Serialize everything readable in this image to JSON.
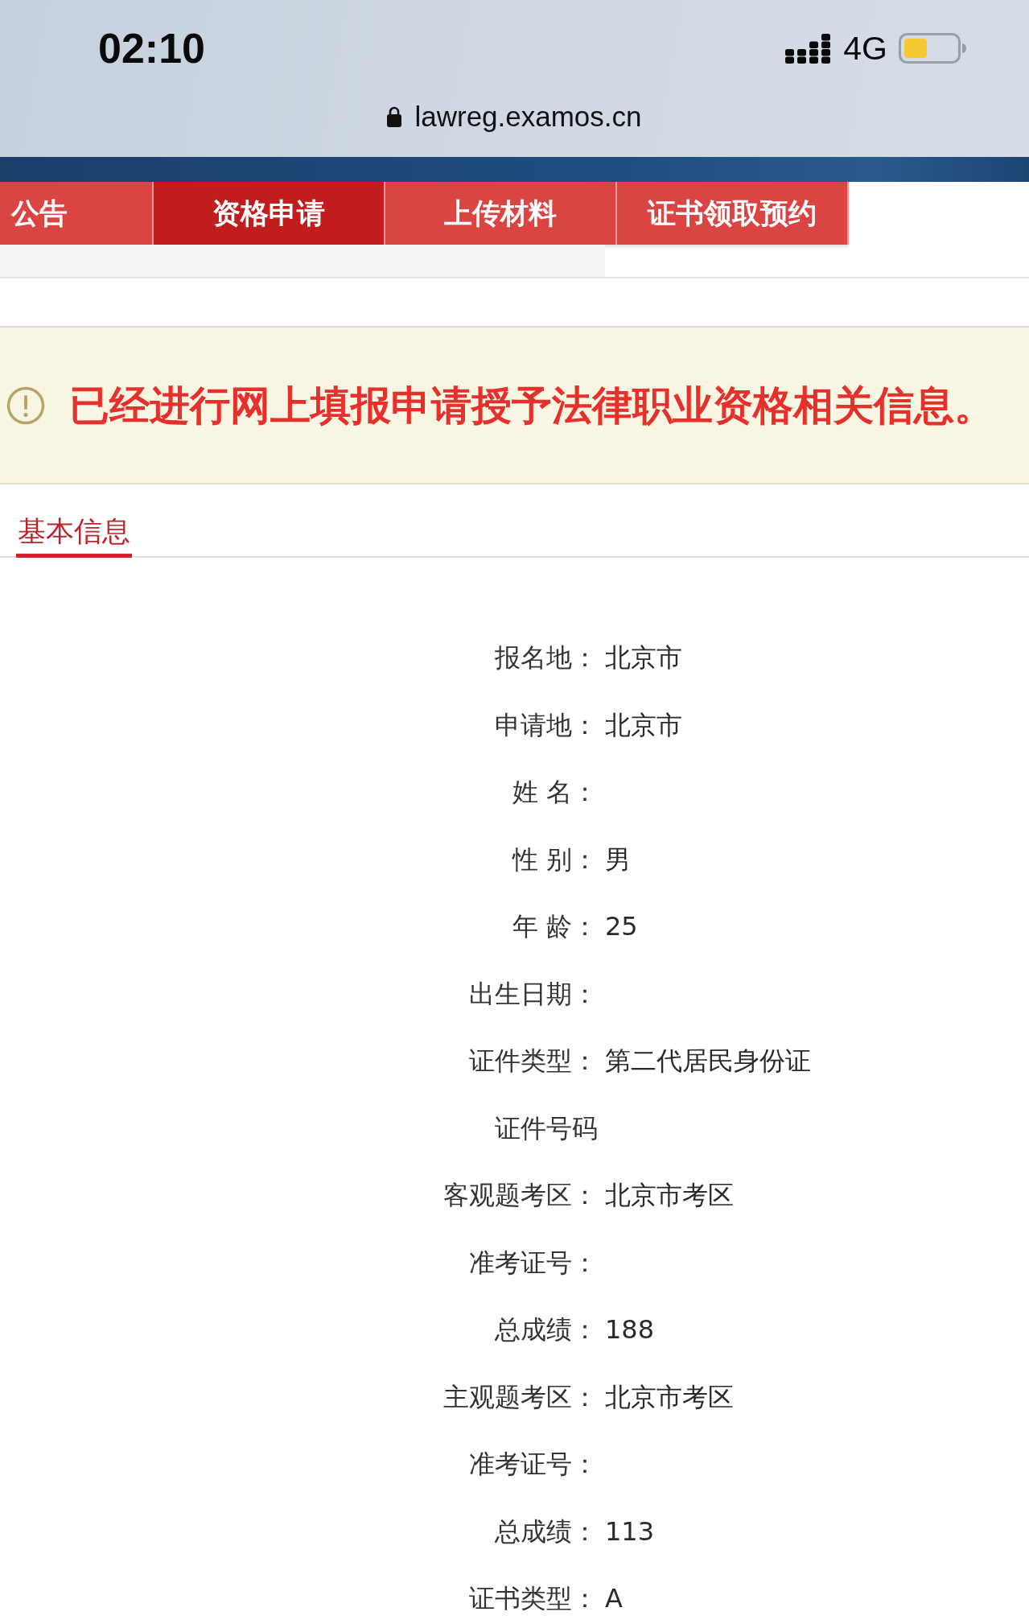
{
  "status_bar": {
    "time": "02:10",
    "network": "4G"
  },
  "address_bar": {
    "url": "lawreg.examos.cn"
  },
  "nav_tabs": [
    {
      "label": "公告",
      "selected": false
    },
    {
      "label": "资格申请",
      "selected": true
    },
    {
      "label": "上传材料",
      "selected": false
    },
    {
      "label": "证书领取预约",
      "selected": false
    }
  ],
  "notice": {
    "message": "已经进行网上填报申请授予法律职业资格相关信息。"
  },
  "section_tabs": [
    {
      "label": "基本信息",
      "selected": true
    }
  ],
  "fields": [
    {
      "label": "报名地：",
      "value": "北京市"
    },
    {
      "label": "申请地：",
      "value": "北京市"
    },
    {
      "label": "姓 名："
    },
    {
      "label": "性 别：",
      "value": "男"
    },
    {
      "label": "年 龄：",
      "value": "25"
    },
    {
      "label": "出生日期："
    },
    {
      "label": "证件类型：",
      "value": "第二代居民身份证"
    },
    {
      "label": "证件号码"
    },
    {
      "label": "客观题考区：",
      "value": "北京市考区"
    },
    {
      "label": "准考证号："
    },
    {
      "label": "总成绩：",
      "value": "188"
    },
    {
      "label": "主观题考区：",
      "value": "北京市考区"
    },
    {
      "label": "准考证号："
    },
    {
      "label": "总成绩：",
      "value": "113"
    },
    {
      "label": "证书类型：",
      "value": "A"
    }
  ]
}
